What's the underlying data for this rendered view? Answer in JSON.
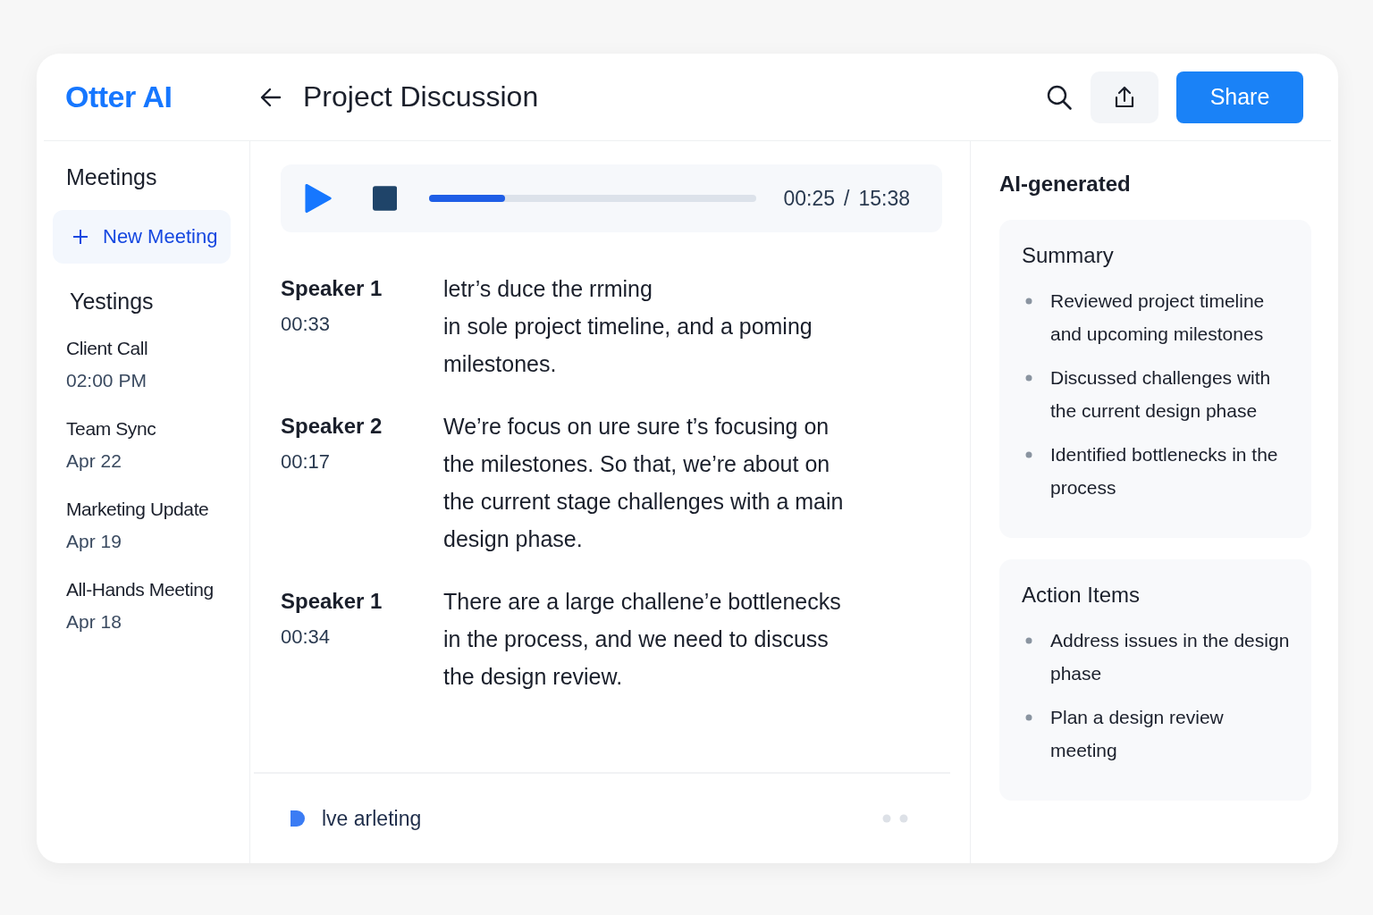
{
  "app": {
    "logo": "Otter AI",
    "title": "Project Discussion",
    "share_label": "Share"
  },
  "sidebar": {
    "heading": "Meetings",
    "new_meeting": "New Meeting",
    "section": "Yestings",
    "items": [
      {
        "name": "Client Call",
        "date": "02:00 PM"
      },
      {
        "name": "Team Sync",
        "date": "Apr 22"
      },
      {
        "name": "Marketing Update",
        "date": "Apr 19"
      },
      {
        "name": "All-Hands Meeting",
        "date": "Apr 18"
      }
    ]
  },
  "player": {
    "level": 0.23,
    "elapsed": "00:25",
    "separator": "/",
    "total": "15:38"
  },
  "transcript": [
    {
      "speaker": "Speaker 1",
      "time": "00:33",
      "lines": [
        "letr’s duce the rrming",
        "in sole project timeline, and a poming",
        "milestones."
      ]
    },
    {
      "speaker": "Speaker 2",
      "time": "00:17",
      "lines": [
        "We’re focus on ure sure t’s focusing on",
        "the milestones. So that, we’re about  on",
        "the current stage challenges with a  main",
        "design phase."
      ]
    },
    {
      "speaker": "Speaker 1",
      "time": "00:34",
      "lines": [
        "There are a large challene’e  bottlenecks",
        "in the process, and we need to discuss",
        "the design review."
      ]
    }
  ],
  "footer": {
    "label": "lve arleting"
  },
  "ai_panel": {
    "heading": "AI-generated",
    "sections": [
      {
        "title": "Summary",
        "items": [
          "Reviewed project timeline and upcoming milestones",
          "Discussed challenges with the current design phase",
          "Identified bottlenecks in the process"
        ]
      },
      {
        "title": "Action Items",
        "items": [
          "Address issues in the design phase",
          "Plan a design review meeting"
        ]
      }
    ]
  }
}
